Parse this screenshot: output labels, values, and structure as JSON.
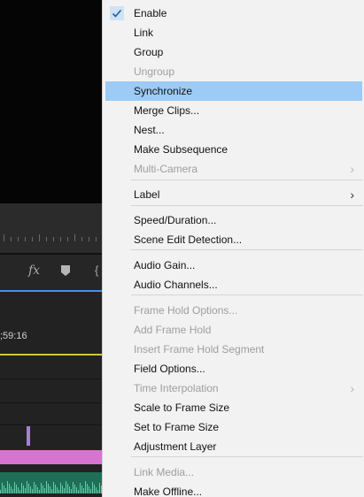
{
  "timeline": {
    "timecode": ";59:16",
    "fx_label": "fx"
  },
  "menu": {
    "items": [
      {
        "label": "Enable",
        "checked": true
      },
      {
        "label": "Link"
      },
      {
        "label": "Group"
      },
      {
        "label": "Ungroup",
        "disabled": true
      },
      {
        "label": "Synchronize",
        "highlighted": true
      },
      {
        "label": "Merge Clips..."
      },
      {
        "label": "Nest..."
      },
      {
        "label": "Make Subsequence"
      },
      {
        "label": "Multi-Camera",
        "disabled": true,
        "submenu": true
      },
      {
        "label": "Label",
        "submenu": true
      },
      {
        "label": "Speed/Duration..."
      },
      {
        "label": "Scene Edit Detection..."
      },
      {
        "label": "Audio Gain..."
      },
      {
        "label": "Audio Channels..."
      },
      {
        "label": "Frame Hold Options...",
        "disabled": true
      },
      {
        "label": "Add Frame Hold",
        "disabled": true
      },
      {
        "label": "Insert Frame Hold Segment",
        "disabled": true
      },
      {
        "label": "Field Options..."
      },
      {
        "label": "Time Interpolation",
        "disabled": true,
        "submenu": true
      },
      {
        "label": "Scale to Frame Size"
      },
      {
        "label": "Set to Frame Size"
      },
      {
        "label": "Adjustment Layer"
      },
      {
        "label": "Link Media...",
        "disabled": true
      },
      {
        "label": "Make Offline..."
      }
    ],
    "submenu_glyph": "›",
    "highlight_color": "#9ccbf5",
    "disabled_color": "#9e9e9e"
  }
}
